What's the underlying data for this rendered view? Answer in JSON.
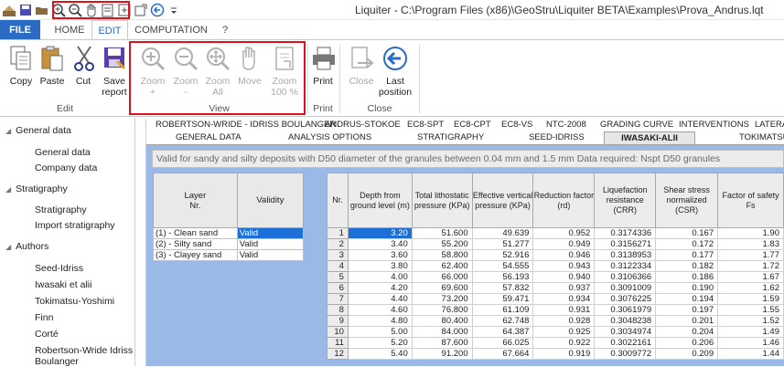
{
  "window": {
    "title": "Liquiter - C:\\Program Files (x86)\\GeoStru\\Liquiter BETA\\Examples\\Prova_Andrus.lqt"
  },
  "quick_access": {
    "icons": [
      "app-icon",
      "save-icon",
      "open-icon",
      "zoom-in-icon",
      "zoom-out-icon",
      "pan-hand-icon",
      "zoom-page-icon",
      "zoom-all-icon",
      "export-icon",
      "back-arrow-icon",
      "dropdown-icon"
    ]
  },
  "ribbon_tabs": [
    "FILE",
    "HOME",
    "EDIT",
    "COMPUTATION",
    "?"
  ],
  "ribbon": {
    "edit": {
      "copy": "Copy",
      "paste": "Paste",
      "cut": "Cut",
      "save_report_1": "Save",
      "save_report_2": "report",
      "label": "Edit"
    },
    "view": {
      "zoom_plus_1": "Zoom",
      "zoom_plus_2": "+",
      "zoom_minus_1": "Zoom",
      "zoom_minus_2": "-",
      "zoom_all_1": "Zoom",
      "zoom_all_2": "All",
      "move": "Move",
      "zoom100_1": "Zoom",
      "zoom100_2": "100 %",
      "label": "View"
    },
    "print": {
      "print": "Print",
      "label": "Print"
    },
    "close": {
      "close": "Close",
      "last_position_1": "Last",
      "last_position_2": "position",
      "label": "Close"
    }
  },
  "sidebar": {
    "groups": [
      {
        "title": "General data",
        "items": [
          "General data",
          "Company data"
        ]
      },
      {
        "title": "Stratigraphy",
        "items": [
          "Stratigraphy",
          "Import stratigraphy"
        ]
      },
      {
        "title": "Authors",
        "items": [
          "Seed-Idriss",
          "Iwasaki et alii",
          "Tokimatsu-Yoshimi",
          "Finn",
          "Corté",
          "Robertson-Wride Idriss",
          "Boulanger"
        ]
      }
    ]
  },
  "main_tabs_row1": [
    "ROBERTSON-WRIDE - IDRISS BOULANGER",
    "ANDRUS-STOKOE",
    "EC8-SPT",
    "EC8-CPT",
    "EC8-VS",
    "NTC-2008",
    "GRADING CURVE",
    "INTERVENTIONS",
    "LATERA"
  ],
  "main_tabs_row2": [
    "GENERAL DATA",
    "ANALYSIS OPTIONS",
    "STRATIGRAPHY",
    "SEED-IDRISS",
    "IWASAKI-ALII",
    "TOKIMATSU-"
  ],
  "info_text": "Valid for sandy and silty deposits with D50 diameter of the granules between 0.04 mm and 1.5 mm Data required: Nspt D50 granules",
  "layer_table": {
    "headers": [
      "Layer\nNr.",
      "Validity"
    ],
    "rows": [
      [
        "(1) - Clean sand",
        "Valid"
      ],
      [
        "(2) - Silty sand",
        "Valid"
      ],
      [
        "(3) - Clayey sand",
        "Valid"
      ]
    ]
  },
  "results_table": {
    "headers": [
      "Nr.",
      "Depth from ground level (m)",
      "Total lithostatic pressure (KPa)",
      "Effective vertical pressure (KPa)",
      "Reduction factor (rd)",
      "Liquefaction resistance (CRR)",
      "Shear stress normalized (CSR)",
      "Factor of safety Fs"
    ],
    "rows": [
      [
        "1",
        "3.20",
        "51.600",
        "49.639",
        "0.952",
        "0.3174336",
        "0.167",
        "1.90"
      ],
      [
        "2",
        "3.40",
        "55.200",
        "51.277",
        "0.949",
        "0.3156271",
        "0.172",
        "1.83"
      ],
      [
        "3",
        "3.60",
        "58.800",
        "52.916",
        "0.946",
        "0.3138953",
        "0.177",
        "1.77"
      ],
      [
        "4",
        "3.80",
        "62.400",
        "54.555",
        "0.943",
        "0.3122334",
        "0.182",
        "1.72"
      ],
      [
        "5",
        "4.00",
        "66.000",
        "56.193",
        "0.940",
        "0.3106366",
        "0.186",
        "1.67"
      ],
      [
        "6",
        "4.20",
        "69.600",
        "57.832",
        "0.937",
        "0.3091009",
        "0.190",
        "1.62"
      ],
      [
        "7",
        "4.40",
        "73.200",
        "59.471",
        "0.934",
        "0.3076225",
        "0.194",
        "1.59"
      ],
      [
        "8",
        "4.60",
        "76.800",
        "61.109",
        "0.931",
        "0.3061979",
        "0.197",
        "1.55"
      ],
      [
        "9",
        "4.80",
        "80.400",
        "62.748",
        "0.928",
        "0.3048238",
        "0.201",
        "1.52"
      ],
      [
        "10",
        "5.00",
        "84.000",
        "64.387",
        "0.925",
        "0.3034974",
        "0.204",
        "1.49"
      ],
      [
        "11",
        "5.20",
        "87.600",
        "66.025",
        "0.922",
        "0.3022161",
        "0.206",
        "1.46"
      ],
      [
        "12",
        "5.40",
        "91.200",
        "67.664",
        "0.919",
        "0.3009772",
        "0.209",
        "1.44"
      ]
    ]
  },
  "colors": {
    "accent": "#2b6bc3",
    "highlight": "#e0101a",
    "content_bg": "#9ab9e6",
    "selection": "#1d6fd8"
  }
}
